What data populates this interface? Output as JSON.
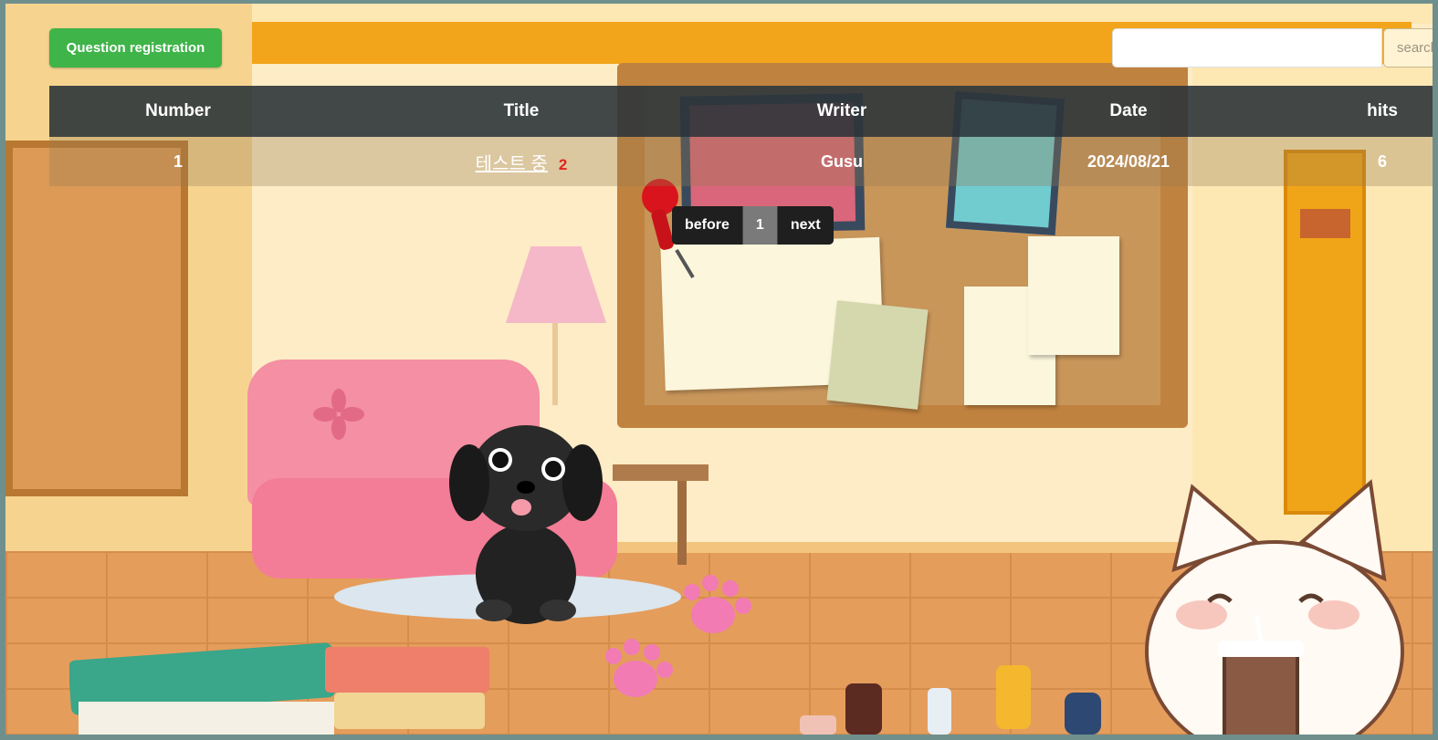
{
  "toolbar": {
    "register_label": "Question registration",
    "search_placeholder": "",
    "search_label": "search"
  },
  "table": {
    "headers": [
      "Number",
      "Title",
      "Writer",
      "Date",
      "hits"
    ],
    "rows": [
      {
        "number": "1",
        "title": "테스트 중",
        "comments": "2",
        "writer": "Gusu",
        "date": "2024/08/21",
        "hits": "6"
      }
    ]
  },
  "pagination": {
    "prev_label": "before",
    "pages": [
      "1"
    ],
    "current": "1",
    "next_label": "next"
  },
  "colors": {
    "register_button": "#3fb449",
    "header_bar": "#2e353a",
    "comment_count": "#e4231b",
    "ceiling_band": "#f2a51b"
  }
}
